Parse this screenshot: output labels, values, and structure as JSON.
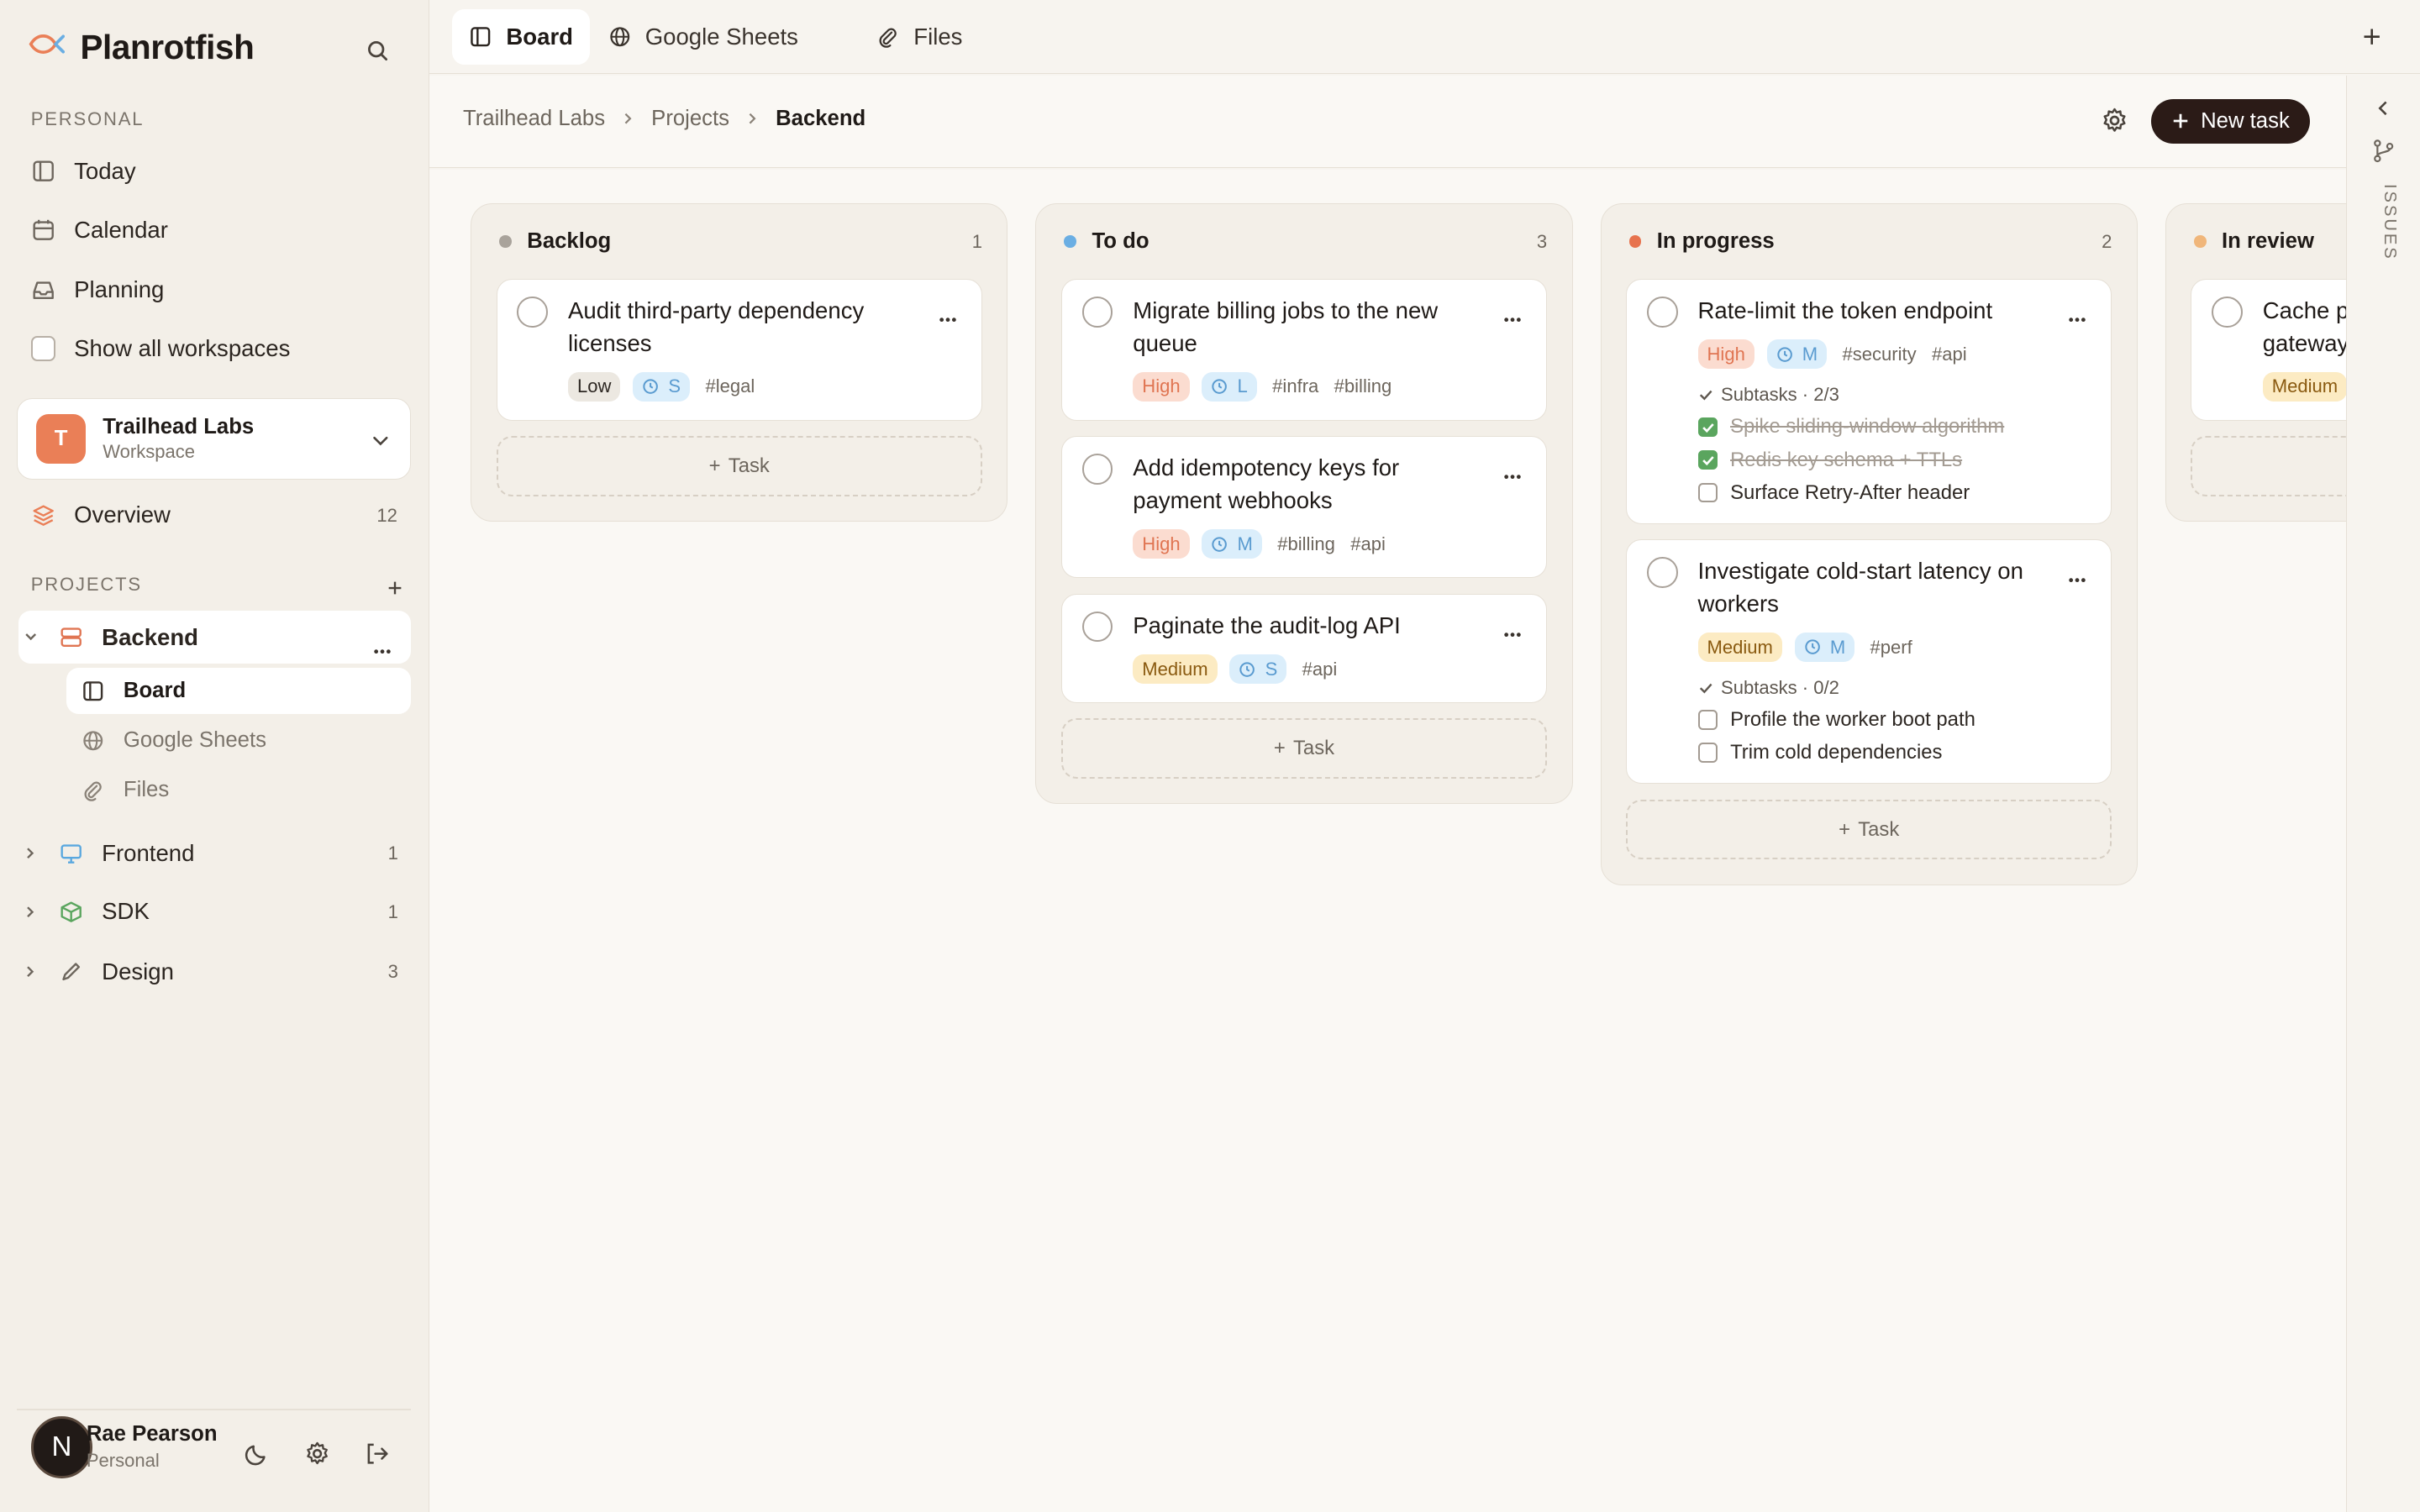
{
  "app": {
    "name": "Planrotfish"
  },
  "sidebar": {
    "personal_label": "PERSONAL",
    "nav": [
      {
        "label": "Today",
        "icon": "layout-icon"
      },
      {
        "label": "Calendar",
        "icon": "calendar-icon"
      },
      {
        "label": "Planning",
        "icon": "inbox-icon"
      }
    ],
    "show_all_label": "Show all workspaces",
    "workspace": {
      "initial": "T",
      "name": "Trailhead Labs",
      "sub": "Workspace"
    },
    "overview": {
      "label": "Overview",
      "count": "12"
    },
    "projects_label": "PROJECTS",
    "projects": [
      {
        "name": "Backend",
        "children": [
          {
            "label": "Board"
          },
          {
            "label": "Google Sheets"
          },
          {
            "label": "Files"
          }
        ]
      },
      {
        "name": "Frontend",
        "count": "1"
      },
      {
        "name": "SDK",
        "count": "1"
      },
      {
        "name": "Design",
        "count": "3"
      }
    ],
    "user": {
      "initial": "N",
      "name": "Rae Pearson",
      "sub": "Personal"
    }
  },
  "tabs": [
    {
      "label": "Board",
      "icon": "board-icon"
    },
    {
      "label": "Google Sheets",
      "icon": "globe-icon"
    },
    {
      "label": "Files",
      "icon": "paperclip-icon"
    }
  ],
  "breadcrumb": [
    "Trailhead Labs",
    "Projects",
    "Backend"
  ],
  "new_task_label": "New task",
  "right_rail_label": "ISSUES",
  "add_task_label": "Task",
  "columns": [
    {
      "title": "Backlog",
      "count": "1",
      "color": "#a9a39b",
      "cards": [
        {
          "title": "Audit third-party dependency licenses",
          "priority": "Low",
          "size": "S",
          "tags": [
            "#legal"
          ]
        }
      ]
    },
    {
      "title": "To do",
      "count": "3",
      "color": "#6aaee3",
      "cards": [
        {
          "title": "Migrate billing jobs to the new queue",
          "priority": "High",
          "size": "L",
          "tags": [
            "#infra",
            "#billing"
          ]
        },
        {
          "title": "Add idempotency keys for payment webhooks",
          "priority": "High",
          "size": "M",
          "tags": [
            "#billing",
            "#api"
          ]
        },
        {
          "title": "Paginate the audit-log API",
          "priority": "Medium",
          "size": "S",
          "tags": [
            "#api"
          ]
        }
      ]
    },
    {
      "title": "In progress",
      "count": "2",
      "color": "#e7734e",
      "cards": [
        {
          "title": "Rate-limit the token endpoint",
          "priority": "High",
          "size": "M",
          "tags": [
            "#security",
            "#api"
          ],
          "subtasks_label": "Subtasks · 2/3",
          "subtasks": [
            {
              "label": "Spike sliding-window algorithm",
              "done": true
            },
            {
              "label": "Redis key schema + TTLs",
              "done": true
            },
            {
              "label": "Surface Retry-After header",
              "done": false
            }
          ]
        },
        {
          "title": "Investigate cold-start latency on workers",
          "priority": "Medium",
          "size": "M",
          "tags": [
            "#perf"
          ],
          "subtasks_label": "Subtasks · 0/2",
          "subtasks": [
            {
              "label": "Profile the worker boot path",
              "done": false
            },
            {
              "label": "Trim cold dependencies",
              "done": false
            }
          ]
        }
      ]
    },
    {
      "title": "In review",
      "count": "",
      "color": "#f0b67a",
      "cards": [
        {
          "title": "Cache p gateway",
          "priority": "Medium",
          "size": "",
          "tags": []
        }
      ]
    }
  ]
}
